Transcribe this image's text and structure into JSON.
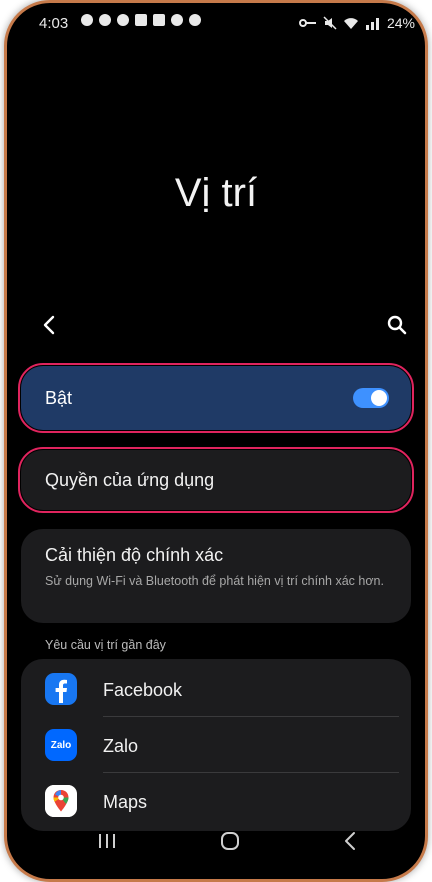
{
  "status_bar": {
    "time": "4:03",
    "battery": "24%"
  },
  "header": {
    "title": "Vị trí"
  },
  "location_toggle": {
    "label": "Bật",
    "enabled": true
  },
  "app_permissions": {
    "label": "Quyền của ứng dụng"
  },
  "accuracy": {
    "title": "Cải thiện độ chính xác",
    "description": "Sử dụng Wi-Fi và Bluetooth để phát hiện vị trí chính xác hơn."
  },
  "recent_requests": {
    "header": "Yêu cầu vị trí gần đây",
    "apps": [
      {
        "name": "Facebook",
        "icon": "facebook-icon"
      },
      {
        "name": "Zalo",
        "icon": "zalo-icon",
        "icon_text": "Zalo"
      },
      {
        "name": "Maps",
        "icon": "google-maps-icon"
      }
    ]
  },
  "colors": {
    "toggle_card_bg": "#1f3a66",
    "switch_on": "#3e91ff",
    "highlight_outline": "#e0245e"
  }
}
